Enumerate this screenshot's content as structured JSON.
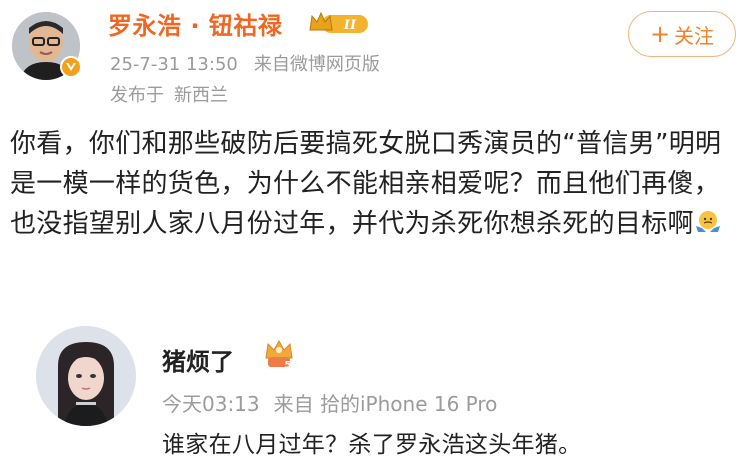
{
  "post": {
    "author": "罗永浩 · 钮祜禄",
    "vip_level": "II",
    "timestamp": "25-7-31 13:50",
    "source": "来自微博网页版",
    "location_prefix": "发布于",
    "location": "新西兰",
    "follow_label": "关注",
    "follow_plus": "+",
    "body": "你看，你们和那些破防后要搞死女脱口秀演员的“普信男”明明是一模一样的货色，为什么不能相亲相爱呢？而且他们再傻，也没指望别人家八月份过年，并代为杀死你想杀死的目标啊",
    "emoji_name": "shrug-emoji-icon"
  },
  "reply": {
    "author": "猪烦了",
    "badge_number": "5",
    "timestamp": "今天03:13",
    "source": "来自 拾的iPhone 16 Pro",
    "text": "谁家在八月过年？杀了罗永浩这头年猪。"
  },
  "colors": {
    "author_orange": "#f06723",
    "meta_gray": "#9b9b9b",
    "follow_border": "#f0b87f",
    "badge_gold": "#f3a11c"
  }
}
